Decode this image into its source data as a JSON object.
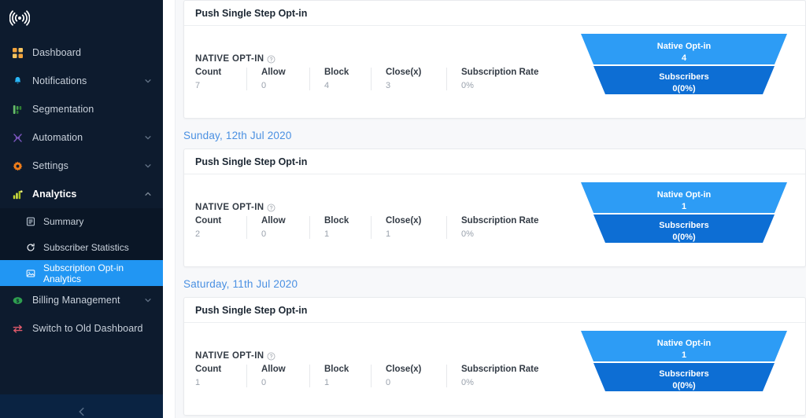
{
  "sidebar": {
    "logo_icon": "broadcast-signal-icon",
    "items": [
      {
        "label": "Dashboard",
        "icon": "grid-icon",
        "color": "#f2a33c",
        "chevron": "none"
      },
      {
        "label": "Notifications",
        "icon": "bell-icon",
        "color": "#29b6f6",
        "chevron": "down"
      },
      {
        "label": "Segmentation",
        "icon": "segment-icon",
        "color": "#43a047",
        "chevron": "none"
      },
      {
        "label": "Automation",
        "icon": "automation-icon",
        "color": "#7e57c2",
        "chevron": "down"
      },
      {
        "label": "Settings",
        "icon": "gear-icon",
        "color": "#ef7d1a",
        "chevron": "down"
      },
      {
        "label": "Analytics",
        "icon": "analytics-icon",
        "color": "#c6d92d",
        "chevron": "up",
        "active": true
      }
    ],
    "subitems": [
      {
        "label": "Summary",
        "icon": "summary-icon",
        "selected": false
      },
      {
        "label": "Subscriber Statistics",
        "icon": "refresh-icon",
        "selected": false
      },
      {
        "label": "Subscription Opt-in Analytics",
        "icon": "image-chart-icon",
        "selected": true
      }
    ],
    "items_after": [
      {
        "label": "Billing Management",
        "icon": "money-icon",
        "color": "#2e9e4f",
        "chevron": "down"
      },
      {
        "label": "Switch to Old Dashboard",
        "icon": "switch-icon",
        "color": "#e05a6b",
        "chevron": "none"
      }
    ],
    "selected_color": "#2196f3",
    "background": "#0d1b2e"
  },
  "main": {
    "card_title": "Push Single Step Opt-in",
    "stats_group_label": "NATIVE OPT-IN",
    "help_icon": "question-circle-icon",
    "columns": [
      "Count",
      "Allow",
      "Block",
      "Close(x)",
      "Subscription Rate"
    ],
    "funnel_colors": {
      "top": "#2d9cf5",
      "bottom": "#0d6ed4"
    },
    "sections": [
      {
        "date": "",
        "show_date": false,
        "stats": {
          "Count": "7",
          "Allow": "0",
          "Block": "4",
          "Close(x)": "3",
          "Subscription Rate": "0%"
        },
        "funnel": {
          "top_label": "Native Opt-in",
          "top_value": "4",
          "bottom_label": "Subscribers",
          "bottom_value": "0(0%)"
        }
      },
      {
        "date": "Sunday, 12th Jul 2020",
        "show_date": true,
        "stats": {
          "Count": "2",
          "Allow": "0",
          "Block": "1",
          "Close(x)": "1",
          "Subscription Rate": "0%"
        },
        "funnel": {
          "top_label": "Native Opt-in",
          "top_value": "1",
          "bottom_label": "Subscribers",
          "bottom_value": "0(0%)"
        }
      },
      {
        "date": "Saturday, 11th Jul 2020",
        "show_date": true,
        "stats": {
          "Count": "1",
          "Allow": "0",
          "Block": "1",
          "Close(x)": "0",
          "Subscription Rate": "0%"
        },
        "funnel": {
          "top_label": "Native Opt-in",
          "top_value": "1",
          "bottom_label": "Subscribers",
          "bottom_value": "0(0%)"
        }
      }
    ]
  }
}
